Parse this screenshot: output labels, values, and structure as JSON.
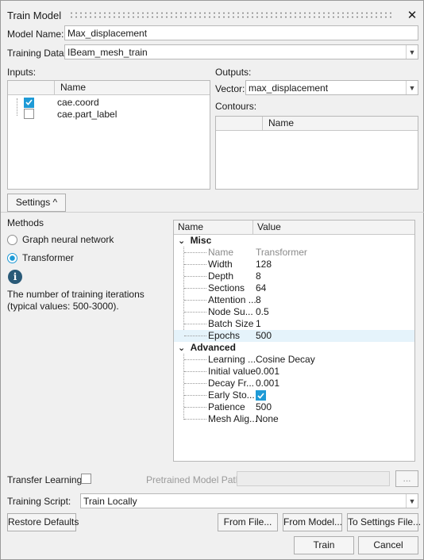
{
  "window": {
    "title": "Train Model",
    "close_glyph": "✕"
  },
  "model_name": {
    "label": "Model Name:",
    "value": "Max_displacement"
  },
  "training_data": {
    "label": "Training Data:",
    "value": "IBeam_mesh_train"
  },
  "inputs": {
    "label": "Inputs:",
    "column": "Name",
    "items": [
      {
        "name": "cae.coord",
        "checked": true
      },
      {
        "name": "cae.part_label",
        "checked": false
      }
    ]
  },
  "outputs": {
    "label": "Outputs:",
    "vector_label": "Vector:",
    "vector_value": "max_displacement",
    "contours_label": "Contours:",
    "contours_column": "Name"
  },
  "settings": {
    "toggle_label": "Settings ^"
  },
  "methods": {
    "label": "Methods",
    "options": [
      {
        "label": "Graph neural network",
        "selected": false
      },
      {
        "label": "Transformer",
        "selected": true
      }
    ],
    "info_glyph": "i",
    "description": "The number of training iterations (typical values: 500-3000)."
  },
  "properties": {
    "col_name": "Name",
    "col_value": "Value",
    "groups": [
      {
        "title": "Misc",
        "rows": [
          {
            "name": "Name",
            "value": "Transformer",
            "disabled": true
          },
          {
            "name": "Width",
            "value": "128"
          },
          {
            "name": "Depth",
            "value": "8"
          },
          {
            "name": "Sections",
            "value": "64"
          },
          {
            "name": "Attention ...",
            "value": "8"
          },
          {
            "name": "Node Su...",
            "value": "0.5"
          },
          {
            "name": "Batch Size",
            "value": "1"
          },
          {
            "name": "Epochs",
            "value": "500",
            "selected": true
          }
        ]
      },
      {
        "title": "Advanced",
        "rows": [
          {
            "name": "Learning ...",
            "value": "Cosine Decay"
          },
          {
            "name": "Initial value",
            "value": "0.001"
          },
          {
            "name": "Decay Fr...",
            "value": "0.001"
          },
          {
            "name": "Early Sto...",
            "value": "",
            "checkbox": true
          },
          {
            "name": "Patience",
            "value": "500"
          },
          {
            "name": "Mesh Alig...",
            "value": "None"
          }
        ]
      }
    ]
  },
  "transfer": {
    "label": "Transfer Learning:",
    "pretrained_label": "Pretrained Model Path:",
    "browse_label": "..."
  },
  "training_script": {
    "label": "Training Script:",
    "value": "Train Locally"
  },
  "buttons": {
    "restore": "Restore Defaults",
    "from_file": "From File...",
    "from_model": "From Model...",
    "to_settings": "To Settings File...",
    "train": "Train",
    "cancel": "Cancel"
  },
  "colors": {
    "accent": "#1e9ad6",
    "selected_row": "#e5f3fb"
  }
}
